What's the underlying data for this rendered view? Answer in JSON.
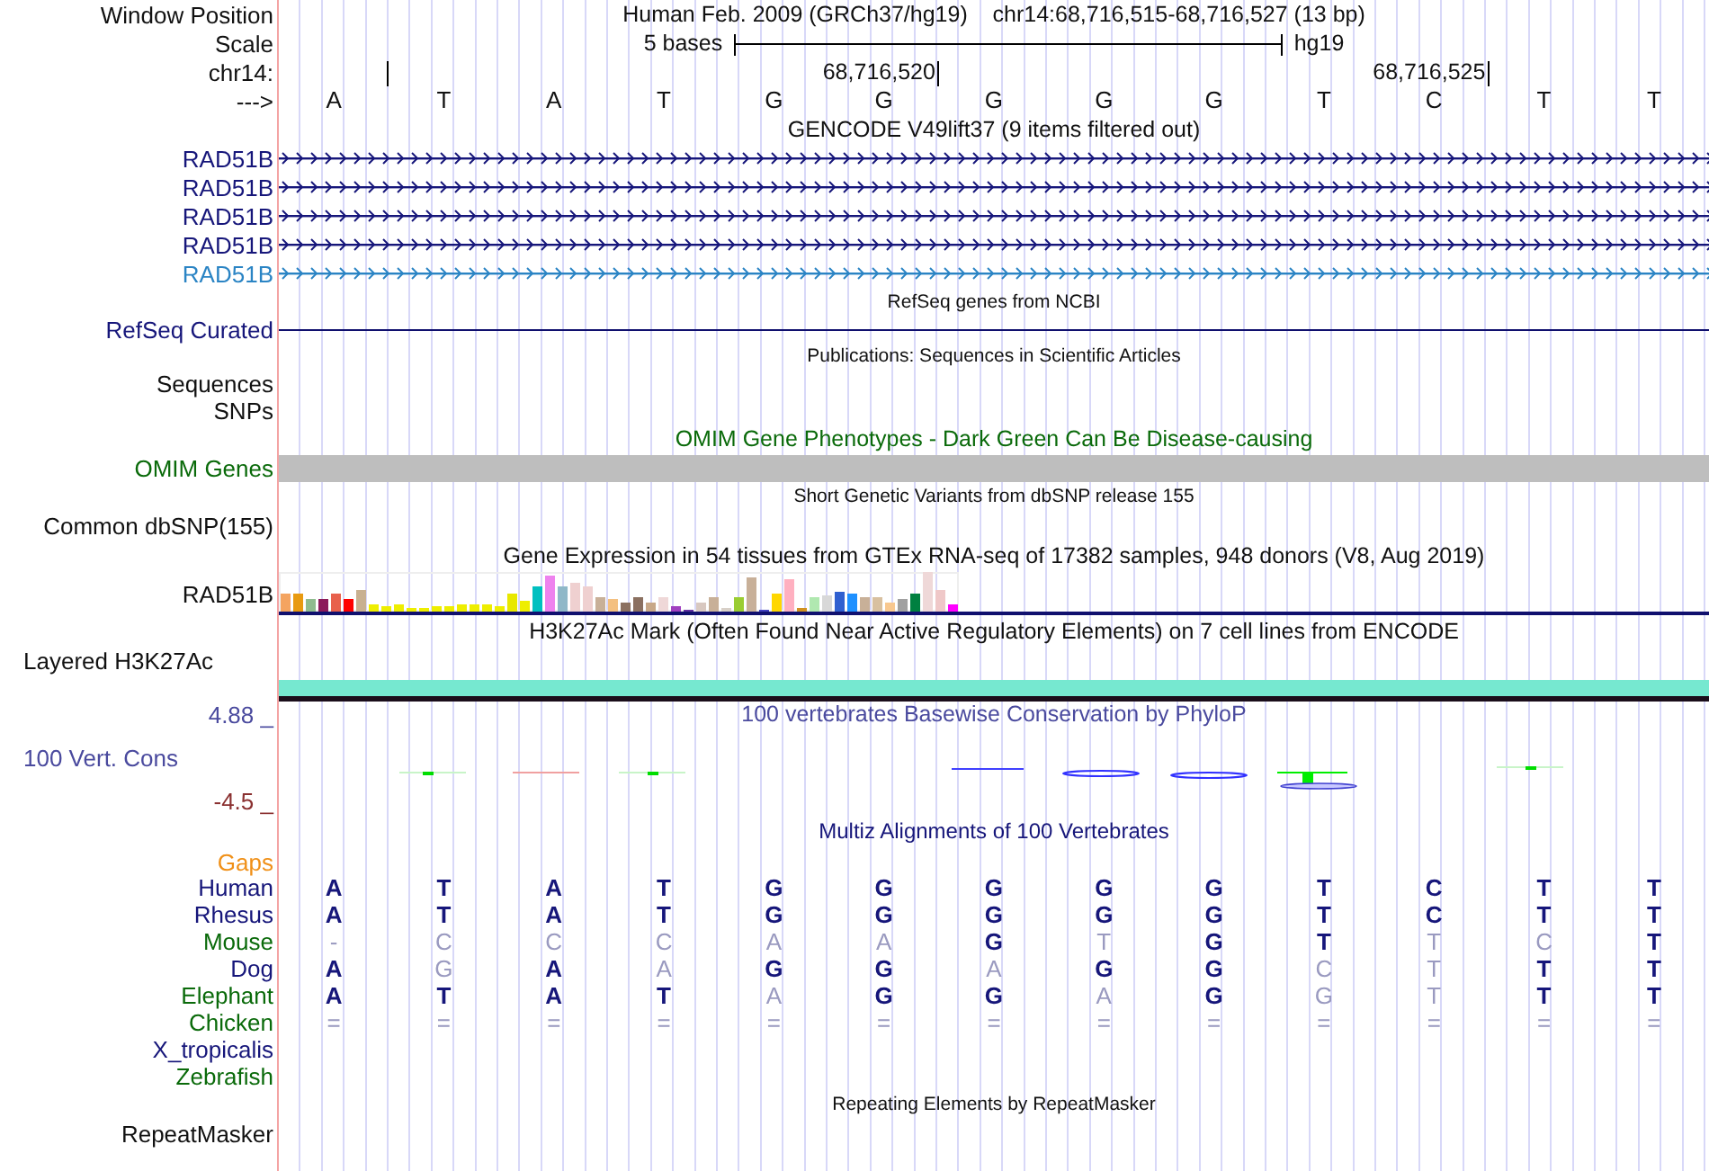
{
  "header": {
    "label": "Window Position",
    "assembly": "Human Feb. 2009 (GRCh37/hg19)",
    "position": "chr14:68,716,515-68,716,527 (13 bp)"
  },
  "scale": {
    "label": "Scale",
    "span": "5 bases",
    "assembly": "hg19"
  },
  "ruler": {
    "label": "chr14:",
    "ticks": [
      "68,716,520",
      "68,716,525"
    ]
  },
  "sequence": {
    "label": "--->",
    "bases": [
      "A",
      "T",
      "A",
      "T",
      "G",
      "G",
      "G",
      "G",
      "G",
      "T",
      "C",
      "T",
      "T"
    ]
  },
  "tracks": [
    {
      "kind": "gene_models",
      "title": "GENCODE V49lift37 (9 items filtered out)",
      "genes": [
        {
          "name": "RAD51B",
          "color": "#16167a"
        },
        {
          "name": "RAD51B",
          "color": "#16167a"
        },
        {
          "name": "RAD51B",
          "color": "#16167a"
        },
        {
          "name": "RAD51B",
          "color": "#16167a"
        },
        {
          "name": "RAD51B",
          "color": "#2a84c4"
        }
      ]
    },
    {
      "kind": "gene_line",
      "title": "RefSeq genes from NCBI",
      "label": "RefSeq Curated"
    },
    {
      "kind": "empty",
      "title": "Publications: Sequences in Scientific Articles",
      "labels": [
        "Sequences",
        "SNPs"
      ]
    },
    {
      "kind": "omim",
      "title": "OMIM Gene Phenotypes - Dark Green Can Be Disease-causing",
      "label": "OMIM Genes"
    },
    {
      "kind": "empty",
      "title": "Short Genetic Variants from dbSNP release 155",
      "labels": [
        "Common dbSNP(155)"
      ]
    },
    {
      "kind": "expression",
      "title": "Gene Expression in 54 tissues from GTEx RNA-seq of 17382 samples, 948 donors (V8, Aug 2019)",
      "label": "RAD51B"
    },
    {
      "kind": "layered",
      "title": "H3K27Ac Mark (Often Found Near Active Regulatory Elements) on 7 cell lines from ENCODE",
      "label": "Layered H3K27Ac"
    },
    {
      "kind": "conservation",
      "title": "100 vertebrates Basewise Conservation by PhyloP",
      "label": "100 Vert. Cons",
      "max": "4.88 _",
      "min": "-4.5 _"
    },
    {
      "kind": "alignment",
      "title": "Multiz Alignments of 100 Vertebrates",
      "gaps_label": "Gaps",
      "species": [
        {
          "name": "Human",
          "color": "#16167a",
          "bases": [
            {
              "base": "A",
              "match": true
            },
            {
              "base": "T",
              "match": true
            },
            {
              "base": "A",
              "match": true
            },
            {
              "base": "T",
              "match": true
            },
            {
              "base": "G",
              "match": true
            },
            {
              "base": "G",
              "match": true
            },
            {
              "base": "G",
              "match": true
            },
            {
              "base": "G",
              "match": true
            },
            {
              "base": "G",
              "match": true
            },
            {
              "base": "T",
              "match": true
            },
            {
              "base": "C",
              "match": true
            },
            {
              "base": "T",
              "match": true
            },
            {
              "base": "T",
              "match": true
            }
          ]
        },
        {
          "name": "Rhesus",
          "color": "#16167a",
          "bases": [
            {
              "base": "A",
              "match": true
            },
            {
              "base": "T",
              "match": true
            },
            {
              "base": "A",
              "match": true
            },
            {
              "base": "T",
              "match": true
            },
            {
              "base": "G",
              "match": true
            },
            {
              "base": "G",
              "match": true
            },
            {
              "base": "G",
              "match": true
            },
            {
              "base": "G",
              "match": true
            },
            {
              "base": "G",
              "match": true
            },
            {
              "base": "T",
              "match": true
            },
            {
              "base": "C",
              "match": true
            },
            {
              "base": "T",
              "match": true
            },
            {
              "base": "T",
              "match": true
            }
          ]
        },
        {
          "name": "Mouse",
          "color": "#0a6a0a",
          "bases": [
            {
              "base": "-",
              "match": false
            },
            {
              "base": "C",
              "match": false
            },
            {
              "base": "C",
              "match": false
            },
            {
              "base": "C",
              "match": false
            },
            {
              "base": "A",
              "match": false
            },
            {
              "base": "A",
              "match": false
            },
            {
              "base": "G",
              "match": true
            },
            {
              "base": "T",
              "match": false
            },
            {
              "base": "G",
              "match": true
            },
            {
              "base": "T",
              "match": true
            },
            {
              "base": "T",
              "match": false
            },
            {
              "base": "C",
              "match": false
            },
            {
              "base": "T",
              "match": true
            }
          ]
        },
        {
          "name": "Dog",
          "color": "#16167a",
          "bases": [
            {
              "base": "A",
              "match": true
            },
            {
              "base": "G",
              "match": false
            },
            {
              "base": "A",
              "match": true
            },
            {
              "base": "A",
              "match": false
            },
            {
              "base": "G",
              "match": true
            },
            {
              "base": "G",
              "match": true
            },
            {
              "base": "A",
              "match": false
            },
            {
              "base": "G",
              "match": true
            },
            {
              "base": "G",
              "match": true
            },
            {
              "base": "C",
              "match": false
            },
            {
              "base": "T",
              "match": false
            },
            {
              "base": "T",
              "match": true
            },
            {
              "base": "T",
              "match": true
            }
          ]
        },
        {
          "name": "Elephant",
          "color": "#0a6a0a",
          "bases": [
            {
              "base": "A",
              "match": true
            },
            {
              "base": "T",
              "match": true
            },
            {
              "base": "A",
              "match": true
            },
            {
              "base": "T",
              "match": true
            },
            {
              "base": "A",
              "match": false
            },
            {
              "base": "G",
              "match": true
            },
            {
              "base": "G",
              "match": true
            },
            {
              "base": "A",
              "match": false
            },
            {
              "base": "G",
              "match": true
            },
            {
              "base": "G",
              "match": false
            },
            {
              "base": "T",
              "match": false
            },
            {
              "base": "T",
              "match": true
            },
            {
              "base": "T",
              "match": true
            }
          ]
        },
        {
          "name": "Chicken",
          "color": "#0a6a0a",
          "bases": [
            {
              "base": "=",
              "match": false
            },
            {
              "base": "=",
              "match": false
            },
            {
              "base": "=",
              "match": false
            },
            {
              "base": "=",
              "match": false
            },
            {
              "base": "=",
              "match": false
            },
            {
              "base": "=",
              "match": false
            },
            {
              "base": "=",
              "match": false
            },
            {
              "base": "=",
              "match": false
            },
            {
              "base": "=",
              "match": false
            },
            {
              "base": "=",
              "match": false
            },
            {
              "base": "=",
              "match": false
            },
            {
              "base": "=",
              "match": false
            },
            {
              "base": "=",
              "match": false
            }
          ]
        },
        {
          "name": "X_tropicalis",
          "color": "#16167a"
        },
        {
          "name": "Zebrafish",
          "color": "#0a6a0a"
        }
      ]
    },
    {
      "kind": "empty",
      "title": "Repeating Elements by RepeatMasker",
      "labels": [
        "RepeatMasker"
      ]
    }
  ]
}
